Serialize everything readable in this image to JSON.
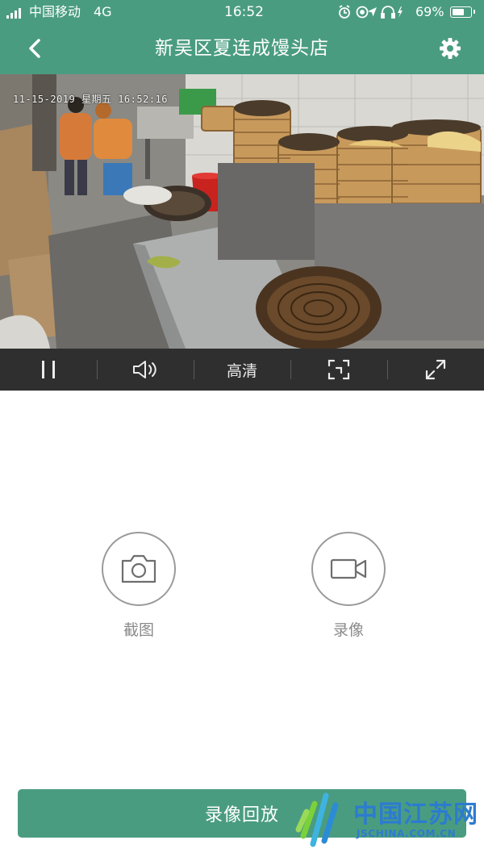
{
  "status_bar": {
    "carrier": "中国移动",
    "network": "4G",
    "time": "16:52",
    "battery_percent": "69%",
    "battery_level": 0.69
  },
  "nav": {
    "title": "新吴区夏连成馒头店",
    "back_icon": "chevron-left-icon",
    "settings_icon": "gear-icon"
  },
  "video": {
    "timestamp": "11-15-2019 星期五 16:52:16",
    "description_icon": "camera-feed"
  },
  "controls": {
    "pause_icon": "pause-icon",
    "volume_icon": "speaker-icon",
    "quality_label": "高清",
    "fit_icon": "fit-screen-icon",
    "fullscreen_icon": "expand-icon"
  },
  "actions": {
    "screenshot_label": "截图",
    "record_label": "录像"
  },
  "playback": {
    "label": "录像回放"
  },
  "watermark": {
    "text": "中国江苏网",
    "sub": "JSCHINA.COM.CN"
  },
  "colors": {
    "brand": "#4a9c80",
    "control_bar": "#2f2f2f",
    "action_gray": "#9a9a9a"
  }
}
